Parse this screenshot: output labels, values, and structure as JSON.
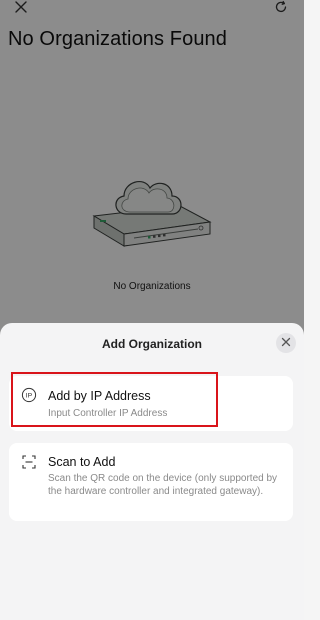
{
  "page": {
    "title": "No Organizations Found",
    "empty_text": "No Organizations"
  },
  "topbar": {
    "close_icon": "close-icon",
    "refresh_icon": "refresh-icon"
  },
  "sheet": {
    "title": "Add Organization",
    "close_icon": "close-icon",
    "options": [
      {
        "icon": "ip-icon",
        "title": "Add by IP Address",
        "description": "Input Controller IP Address",
        "highlighted": true
      },
      {
        "icon": "scan-icon",
        "title": "Scan to Add",
        "description": "Scan the QR code on the device (only supported by the hardware controller and integrated gateway)."
      }
    ]
  },
  "colors": {
    "highlight": "#d9141a",
    "accent": "#3aa866"
  }
}
